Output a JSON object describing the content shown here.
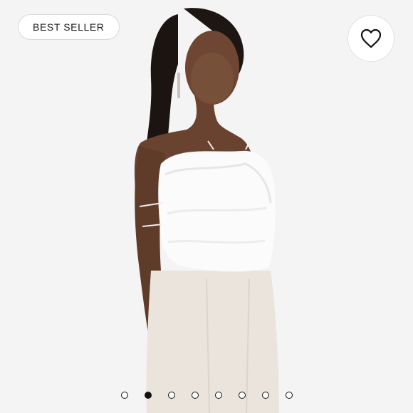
{
  "badge": {
    "label": "BEST SELLER"
  },
  "favorite": {
    "icon": "heart-icon"
  },
  "carousel": {
    "count": 8,
    "active_index": 1
  },
  "colors": {
    "background": "#f4f4f4",
    "dot_active": "#111111",
    "dot_inactive": "#ffffff"
  }
}
